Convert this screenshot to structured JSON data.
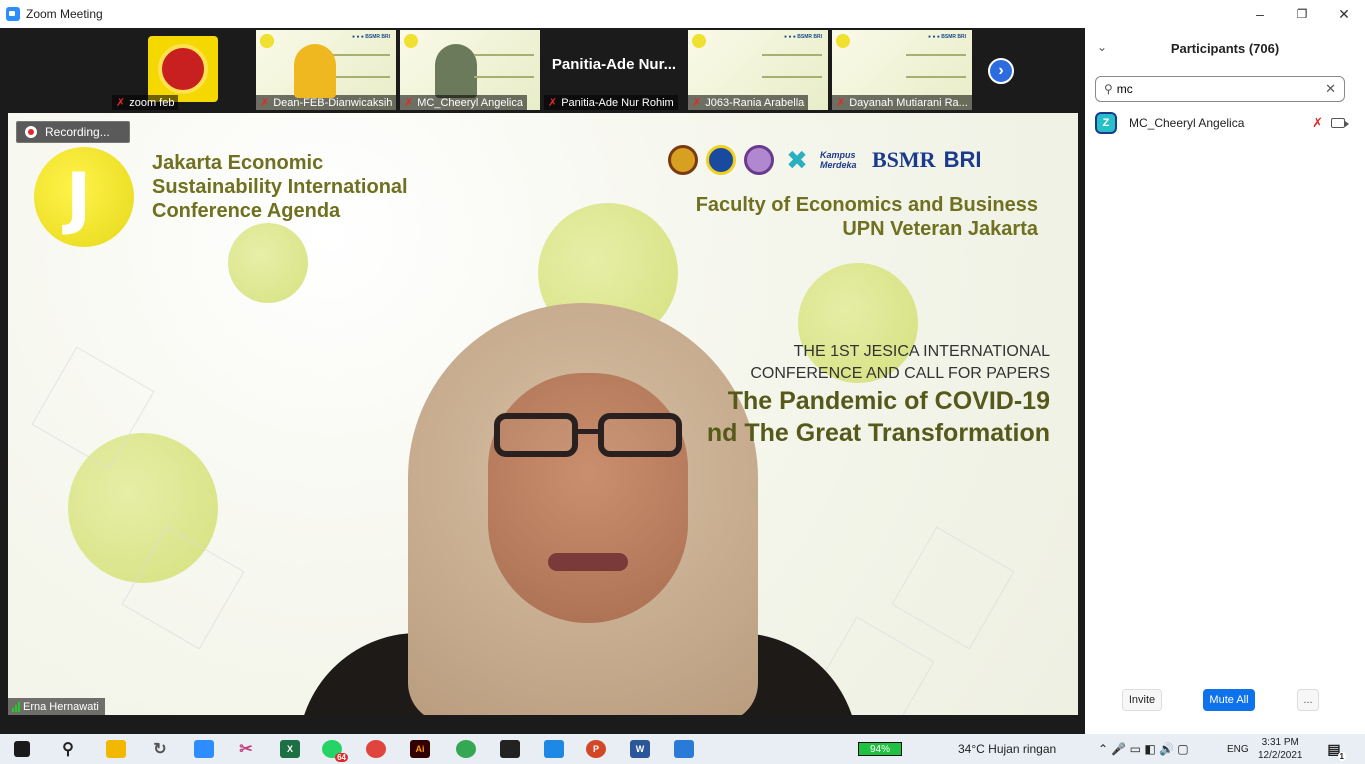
{
  "window": {
    "title": "Zoom Meeting",
    "minimize_glyph": "–",
    "maximize_glyph": "❐",
    "close_glyph": "✕"
  },
  "thumbnails": [
    {
      "name": "zoom feb",
      "kind": "logo"
    },
    {
      "name": "Dean-FEB-Dianwicaksih",
      "kind": "slide"
    },
    {
      "name": "MC_Cheeryl Angelica",
      "kind": "person"
    },
    {
      "name": "Panitia-Ade Nur Rohim",
      "kind": "text",
      "tile_text": "Panitia-Ade Nur..."
    },
    {
      "name": "J063-Rania Arabella",
      "kind": "slide"
    },
    {
      "name": "Dayanah Mutiarani Ra...",
      "kind": "slide"
    }
  ],
  "stage": {
    "recording_label": "Recording...",
    "j_logo_letter": "J",
    "conference_title": [
      "Jakarta Economic",
      "Sustainability International",
      "Conference Agenda"
    ],
    "logos_text": [
      "Kampus Merdeka",
      "BSMR",
      "BRI"
    ],
    "faculty": [
      "Faculty of Economics and Business",
      "UPN Veteran Jakarta"
    ],
    "jesica_sub1": "THE 1ST JESICA INTERNATIONAL",
    "jesica_sub2": "CONFERENCE AND CALL FOR PAPERS",
    "jesica_big1": "The Pandemic of COVID-19",
    "jesica_big2": "nd The Great Transformation",
    "speaker_name": "Erna Hernawati"
  },
  "participants_panel": {
    "title": "Participants (706)",
    "search_value": "mc",
    "participants": [
      {
        "name": "MC_Cheeryl Angelica",
        "avatar_letter": "Z"
      }
    ],
    "invite_label": "Invite",
    "mute_all_label": "Mute All",
    "more_label": "..."
  },
  "taskbar": {
    "battery": "94%",
    "weather": "34°C  Hujan ringan",
    "language": "ENG",
    "time": "3:31 PM",
    "date": "12/2/2021",
    "notification_count": "1",
    "whatsapp_badge": "64"
  },
  "colors": {
    "zoom_blue": "#2d8cff",
    "mute_all_blue": "#0e72ed",
    "muted_red": "#e02828",
    "slide_olive": "#6f7020"
  }
}
